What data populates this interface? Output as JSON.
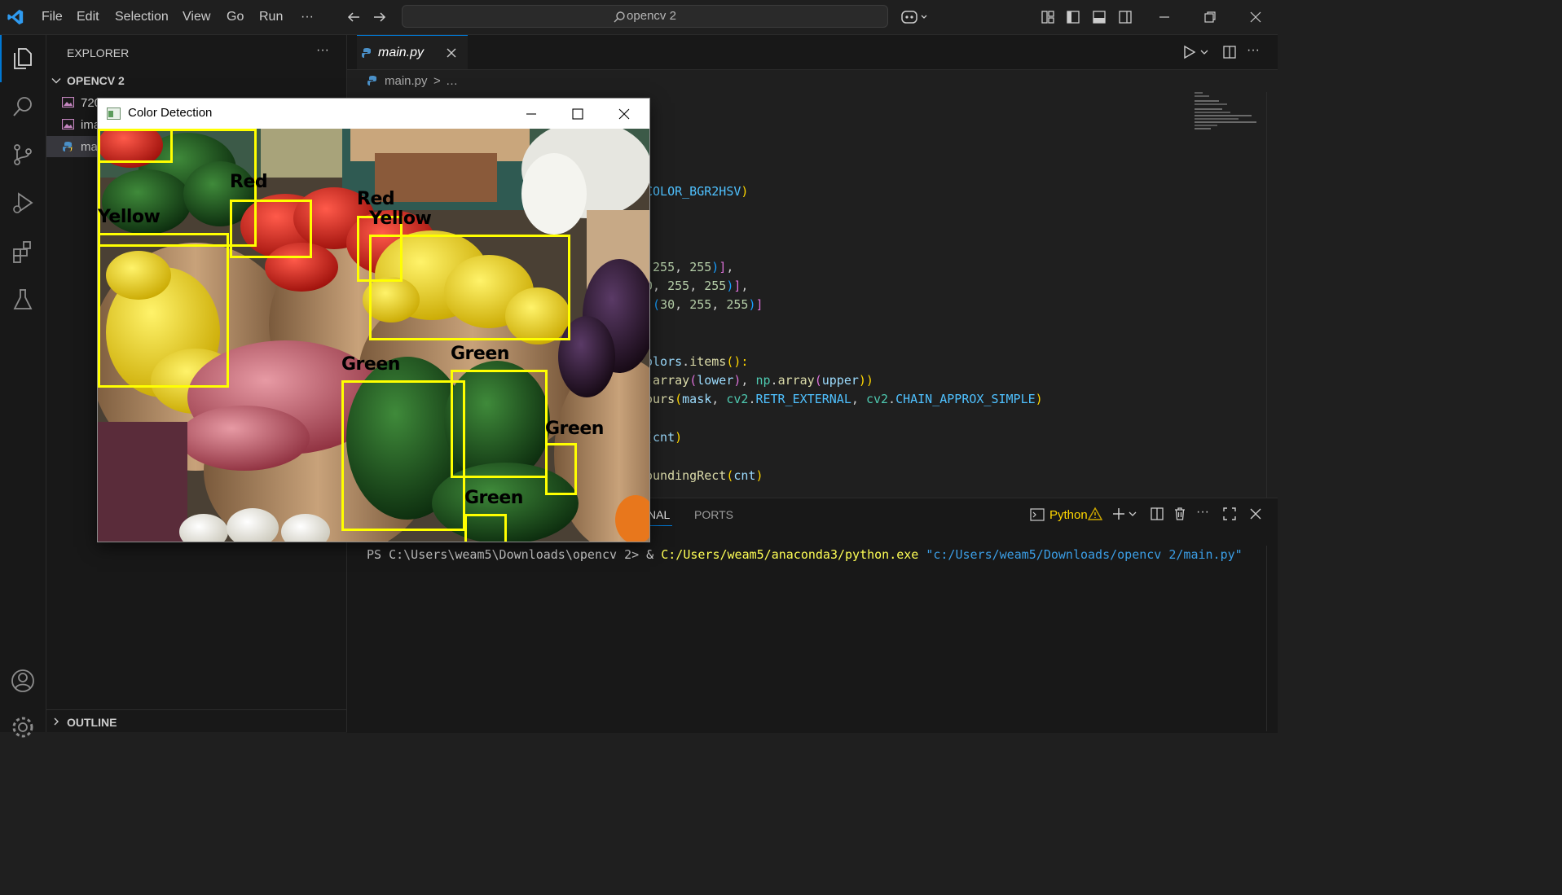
{
  "titlebar": {
    "menu": [
      "File",
      "Edit",
      "Selection",
      "View",
      "Go",
      "Run",
      "···"
    ],
    "search_text": "opencv 2"
  },
  "sidebar": {
    "header": "EXPLORER",
    "more": "···",
    "folder": "OPENCV 2",
    "files": [
      "720",
      "ima",
      "ma"
    ],
    "outline": "OUTLINE"
  },
  "editor": {
    "tab_label": "main.py",
    "breadcrumb_file": "main.py",
    "breadcrumb_rest": "…",
    "code_lines": [
      {
        "row": 1,
        "parts": [
          {
            "t": ")",
            "c": "c-bracket1"
          }
        ]
      },
      {
        "row": 2,
        "parts": [
          {
            "t": "COLOR_BGR2HSV",
            "c": "c-const"
          },
          {
            "t": ")",
            "c": "c-bracket1"
          }
        ]
      },
      {
        "row": 3,
        "parts": [
          {
            "t": " 255",
            "c": "c-num"
          },
          {
            "t": ", ",
            "c": "c-default"
          },
          {
            "t": "255",
            "c": "c-num"
          },
          {
            "t": ")",
            "c": "c-bracket3"
          },
          {
            "t": "]",
            "c": "c-bracket2"
          },
          {
            "t": ",",
            "c": "c-default"
          }
        ]
      },
      {
        "row": 4,
        "parts": [
          {
            "t": "0",
            "c": "c-num"
          },
          {
            "t": ", ",
            "c": "c-default"
          },
          {
            "t": "255",
            "c": "c-num"
          },
          {
            "t": ", ",
            "c": "c-default"
          },
          {
            "t": "255",
            "c": "c-num"
          },
          {
            "t": ")",
            "c": "c-bracket3"
          },
          {
            "t": "]",
            "c": "c-bracket2"
          },
          {
            "t": ",",
            "c": "c-default"
          }
        ]
      },
      {
        "row": 5,
        "parts": [
          {
            "t": " (",
            "c": "c-bracket3"
          },
          {
            "t": "30",
            "c": "c-num"
          },
          {
            "t": ", ",
            "c": "c-default"
          },
          {
            "t": "255",
            "c": "c-num"
          },
          {
            "t": ", ",
            "c": "c-default"
          },
          {
            "t": "255",
            "c": "c-num"
          },
          {
            "t": ")",
            "c": "c-bracket3"
          },
          {
            "t": "]",
            "c": "c-bracket2"
          }
        ]
      },
      {
        "row": 6,
        "parts": [
          {
            "t": "olors",
            "c": "c-var"
          },
          {
            "t": ".",
            "c": "c-default"
          },
          {
            "t": "items",
            "c": "c-func"
          },
          {
            "t": "():",
            "c": "c-bracket1"
          }
        ]
      },
      {
        "row": 7,
        "parts": [
          {
            "t": ".",
            "c": "c-default"
          },
          {
            "t": "array",
            "c": "c-func"
          },
          {
            "t": "(",
            "c": "c-bracket2"
          },
          {
            "t": "lower",
            "c": "c-var"
          },
          {
            "t": ")",
            "c": "c-bracket2"
          },
          {
            "t": ", ",
            "c": "c-default"
          },
          {
            "t": "np",
            "c": "c-cls"
          },
          {
            "t": ".",
            "c": "c-default"
          },
          {
            "t": "array",
            "c": "c-func"
          },
          {
            "t": "(",
            "c": "c-bracket2"
          },
          {
            "t": "upper",
            "c": "c-var"
          },
          {
            "t": "))",
            "c": "c-bracket1"
          }
        ]
      },
      {
        "row": 8,
        "parts": [
          {
            "t": "ours",
            "c": "c-func"
          },
          {
            "t": "(",
            "c": "c-bracket1"
          },
          {
            "t": "mask",
            "c": "c-var"
          },
          {
            "t": ", ",
            "c": "c-default"
          },
          {
            "t": "cv2",
            "c": "c-cls"
          },
          {
            "t": ".",
            "c": "c-default"
          },
          {
            "t": "RETR_EXTERNAL",
            "c": "c-const"
          },
          {
            "t": ", ",
            "c": "c-default"
          },
          {
            "t": "cv2",
            "c": "c-cls"
          },
          {
            "t": ".",
            "c": "c-default"
          },
          {
            "t": "CHAIN_APPROX_SIMPLE",
            "c": "c-const"
          },
          {
            "t": ")",
            "c": "c-bracket1"
          }
        ]
      },
      {
        "row": 9,
        "parts": [
          {
            "t": "(",
            "c": "c-bracket1"
          },
          {
            "t": "cnt",
            "c": "c-var"
          },
          {
            "t": ")",
            "c": "c-bracket1"
          }
        ]
      },
      {
        "row": 10,
        "parts": [
          {
            "t": "oundingRect",
            "c": "c-func"
          },
          {
            "t": "(",
            "c": "c-bracket1"
          },
          {
            "t": "cnt",
            "c": "c-var"
          },
          {
            "t": ")",
            "c": "c-bracket1"
          }
        ]
      }
    ]
  },
  "panel": {
    "tab_terminal": "NAL",
    "tab_ports": "PORTS",
    "shell_label": "Python",
    "prompt": "PS C:\\Users\\weam5\\Downloads\\opencv 2> ",
    "amp": "& ",
    "exe": "C:/Users/weam5/anaconda3/python.exe ",
    "script": "\"c:/Users/weam5/Downloads/opencv 2/main.py\""
  },
  "cv_window": {
    "title": "Color Detection",
    "labels": [
      {
        "text": "Red",
        "color": "red"
      },
      {
        "text": "Yellow",
        "color": "yellow"
      },
      {
        "text": "Red",
        "color": "red"
      },
      {
        "text": "Yellow",
        "color": "yellow"
      },
      {
        "text": "Green",
        "color": "green"
      },
      {
        "text": "Green",
        "color": "green"
      },
      {
        "text": "Green",
        "color": "green"
      },
      {
        "text": "Green",
        "color": "green"
      }
    ]
  },
  "colors": {
    "accent": "#0078d4",
    "box": "#ffff00",
    "python_tab": "#ffd700"
  }
}
